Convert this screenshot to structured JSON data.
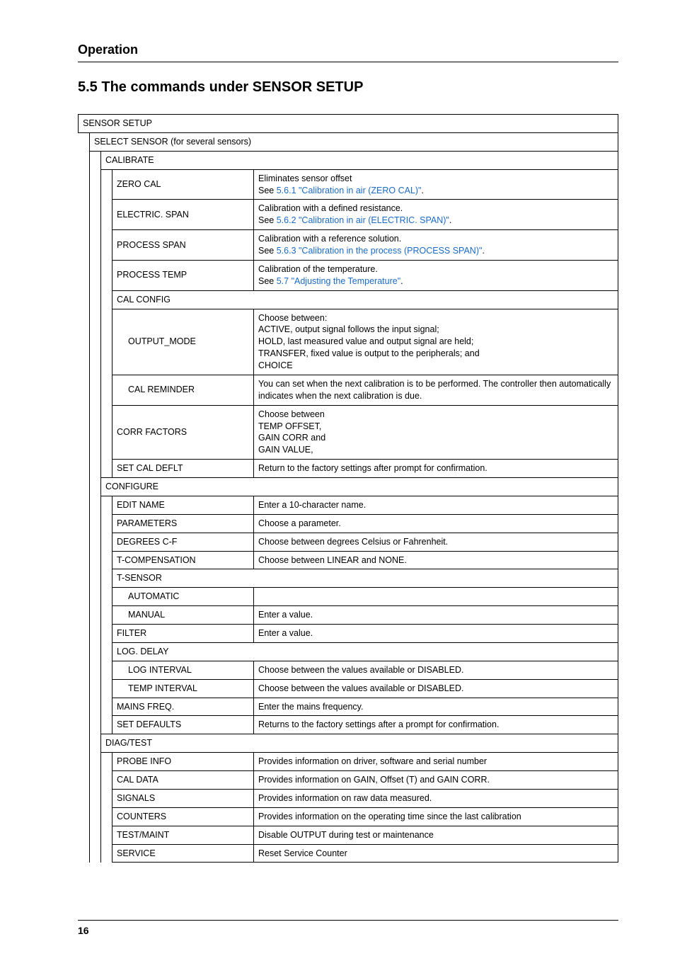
{
  "head": "Operation",
  "title": "5.5   The commands under SENSOR SETUP",
  "pageNumber": "16",
  "t": {
    "sensorSetup": "SENSOR SETUP",
    "selectSensor": "SELECT SENSOR (for several sensors)",
    "calibrate": "CALIBRATE",
    "zeroCal": "ZERO CAL",
    "zeroCalDesc1": "Eliminates sensor offset",
    "zeroCalDesc2a": "See ",
    "zeroCalDesc2link": "5.6.1 \"Calibration in air (ZERO CAL)\"",
    "electricSpan": "ELECTRIC. SPAN",
    "electricSpanDesc1": "Calibration with a defined resistance.",
    "electricSpanDesc2a": "See ",
    "electricSpanDesc2link": "5.6.2 \"Calibration in air (ELECTRIC. SPAN)\"",
    "processSpan": "PROCESS SPAN",
    "processSpanDesc1": "Calibration with a reference solution.",
    "processSpanDesc2a": "See ",
    "processSpanDesc2link": "5.6.3 \"Calibration in the process (PROCESS SPAN)\"",
    "processTemp": "PROCESS TEMP",
    "processTempDesc1": "Calibration of the temperature.",
    "processTempDesc2a": "See ",
    "processTempDesc2link": "5.7 \"Adjusting the Temperature\"",
    "calConfig": "CAL CONFIG",
    "outputMode": "OUTPUT_MODE",
    "outputModeDesc": "Choose between:\nACTIVE, output signal follows the input signal;\nHOLD, last measured value and output signal are held;\nTRANSFER, fixed value is output to the peripherals; and\nCHOICE",
    "calReminder": "CAL REMINDER",
    "calReminderDesc": "You can set when the next calibration is to be performed. The controller then automatically indicates when the next calibration is due.",
    "corrFactors": "CORR FACTORS",
    "corrFactorsDesc": "Choose between\nTEMP OFFSET,\nGAIN CORR and\nGAIN VALUE,",
    "setCalDeflt": "SET CAL DEFLT",
    "setCalDefltDesc": "Return to the factory settings after prompt for confirmation.",
    "configure": "CONFIGURE",
    "editName": "EDIT NAME",
    "editNameDesc": "Enter a 10-character name.",
    "parameters": "PARAMETERS",
    "parametersDesc": "Choose a parameter.",
    "degreesCF": "DEGREES C-F",
    "degreesCFDesc": "Choose between degrees Celsius or Fahrenheit.",
    "tComp": "T-COMPENSATION",
    "tCompDesc": "Choose between LINEAR and NONE.",
    "tSensor": "T-SENSOR",
    "automatic": "AUTOMATIC",
    "manual": "MANUAL",
    "manualDesc": "Enter a value.",
    "filter": "FILTER",
    "filterDesc": "Enter a value.",
    "logDelay": "LOG. DELAY",
    "logInterval": "LOG INTERVAL",
    "logIntervalDesc": "Choose between the values available or DISABLED.",
    "tempInterval": "TEMP INTERVAL",
    "tempIntervalDesc": "Choose between the values available or DISABLED.",
    "mainsFreq": "MAINS FREQ.",
    "mainsFreqDesc": "Enter the mains frequency.",
    "setDefaults": "SET DEFAULTS",
    "setDefaultsDesc": "Returns to the factory settings after a prompt for confirmation.",
    "diagTest": "DIAG/TEST",
    "probeInfo": "PROBE INFO",
    "probeInfoDesc": "Provides information on driver, software and serial number",
    "calData": "CAL DATA",
    "calDataDesc": "Provides information on GAIN, Offset (T) and GAIN CORR.",
    "signals": "SIGNALS",
    "signalsDesc": "Provides information on raw data measured.",
    "counters": "COUNTERS",
    "countersDesc": "Provides information on the operating time since the last calibration",
    "testMaint": "TEST/MAINT",
    "testMaintDesc": "Disable OUTPUT during test or maintenance",
    "service": "SERVICE",
    "serviceDesc": "Reset Service Counter",
    "dot": "."
  }
}
